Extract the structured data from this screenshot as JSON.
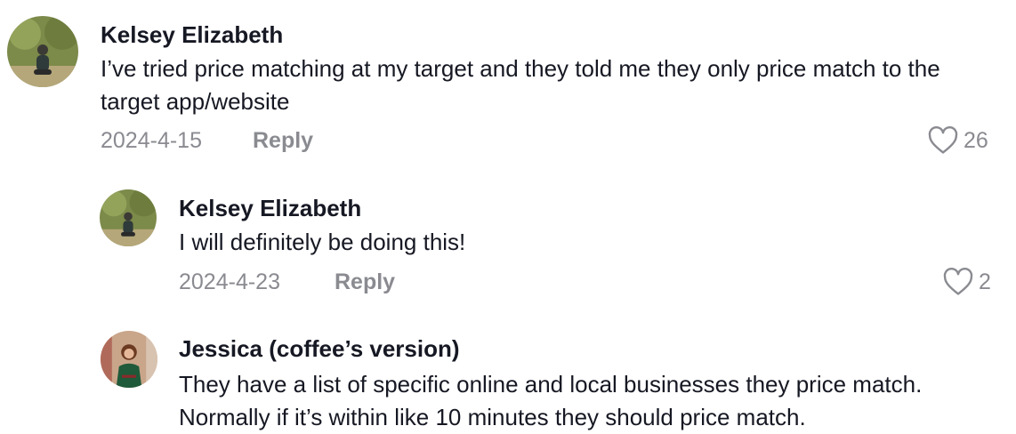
{
  "comments": [
    {
      "author": "Kelsey Elizabeth",
      "text": "I’ve tried price matching at my target and they told me they only price match to the target app/website",
      "date": "2024-4-15",
      "reply_label": "Reply",
      "likes": "26"
    },
    {
      "author": "Kelsey Elizabeth",
      "text": "I will definitely be doing this!",
      "date": "2024-4-23",
      "reply_label": "Reply",
      "likes": "2"
    },
    {
      "author": "Jessica (coffee’s version)",
      "text": "They have a list of specific online and local businesses they price match. Normally if it’s within like 10 minutes they should price match."
    }
  ],
  "colors": {
    "text": "#161823",
    "muted": "#8a8b91"
  },
  "icons": {
    "like": "heart-outline-icon"
  }
}
